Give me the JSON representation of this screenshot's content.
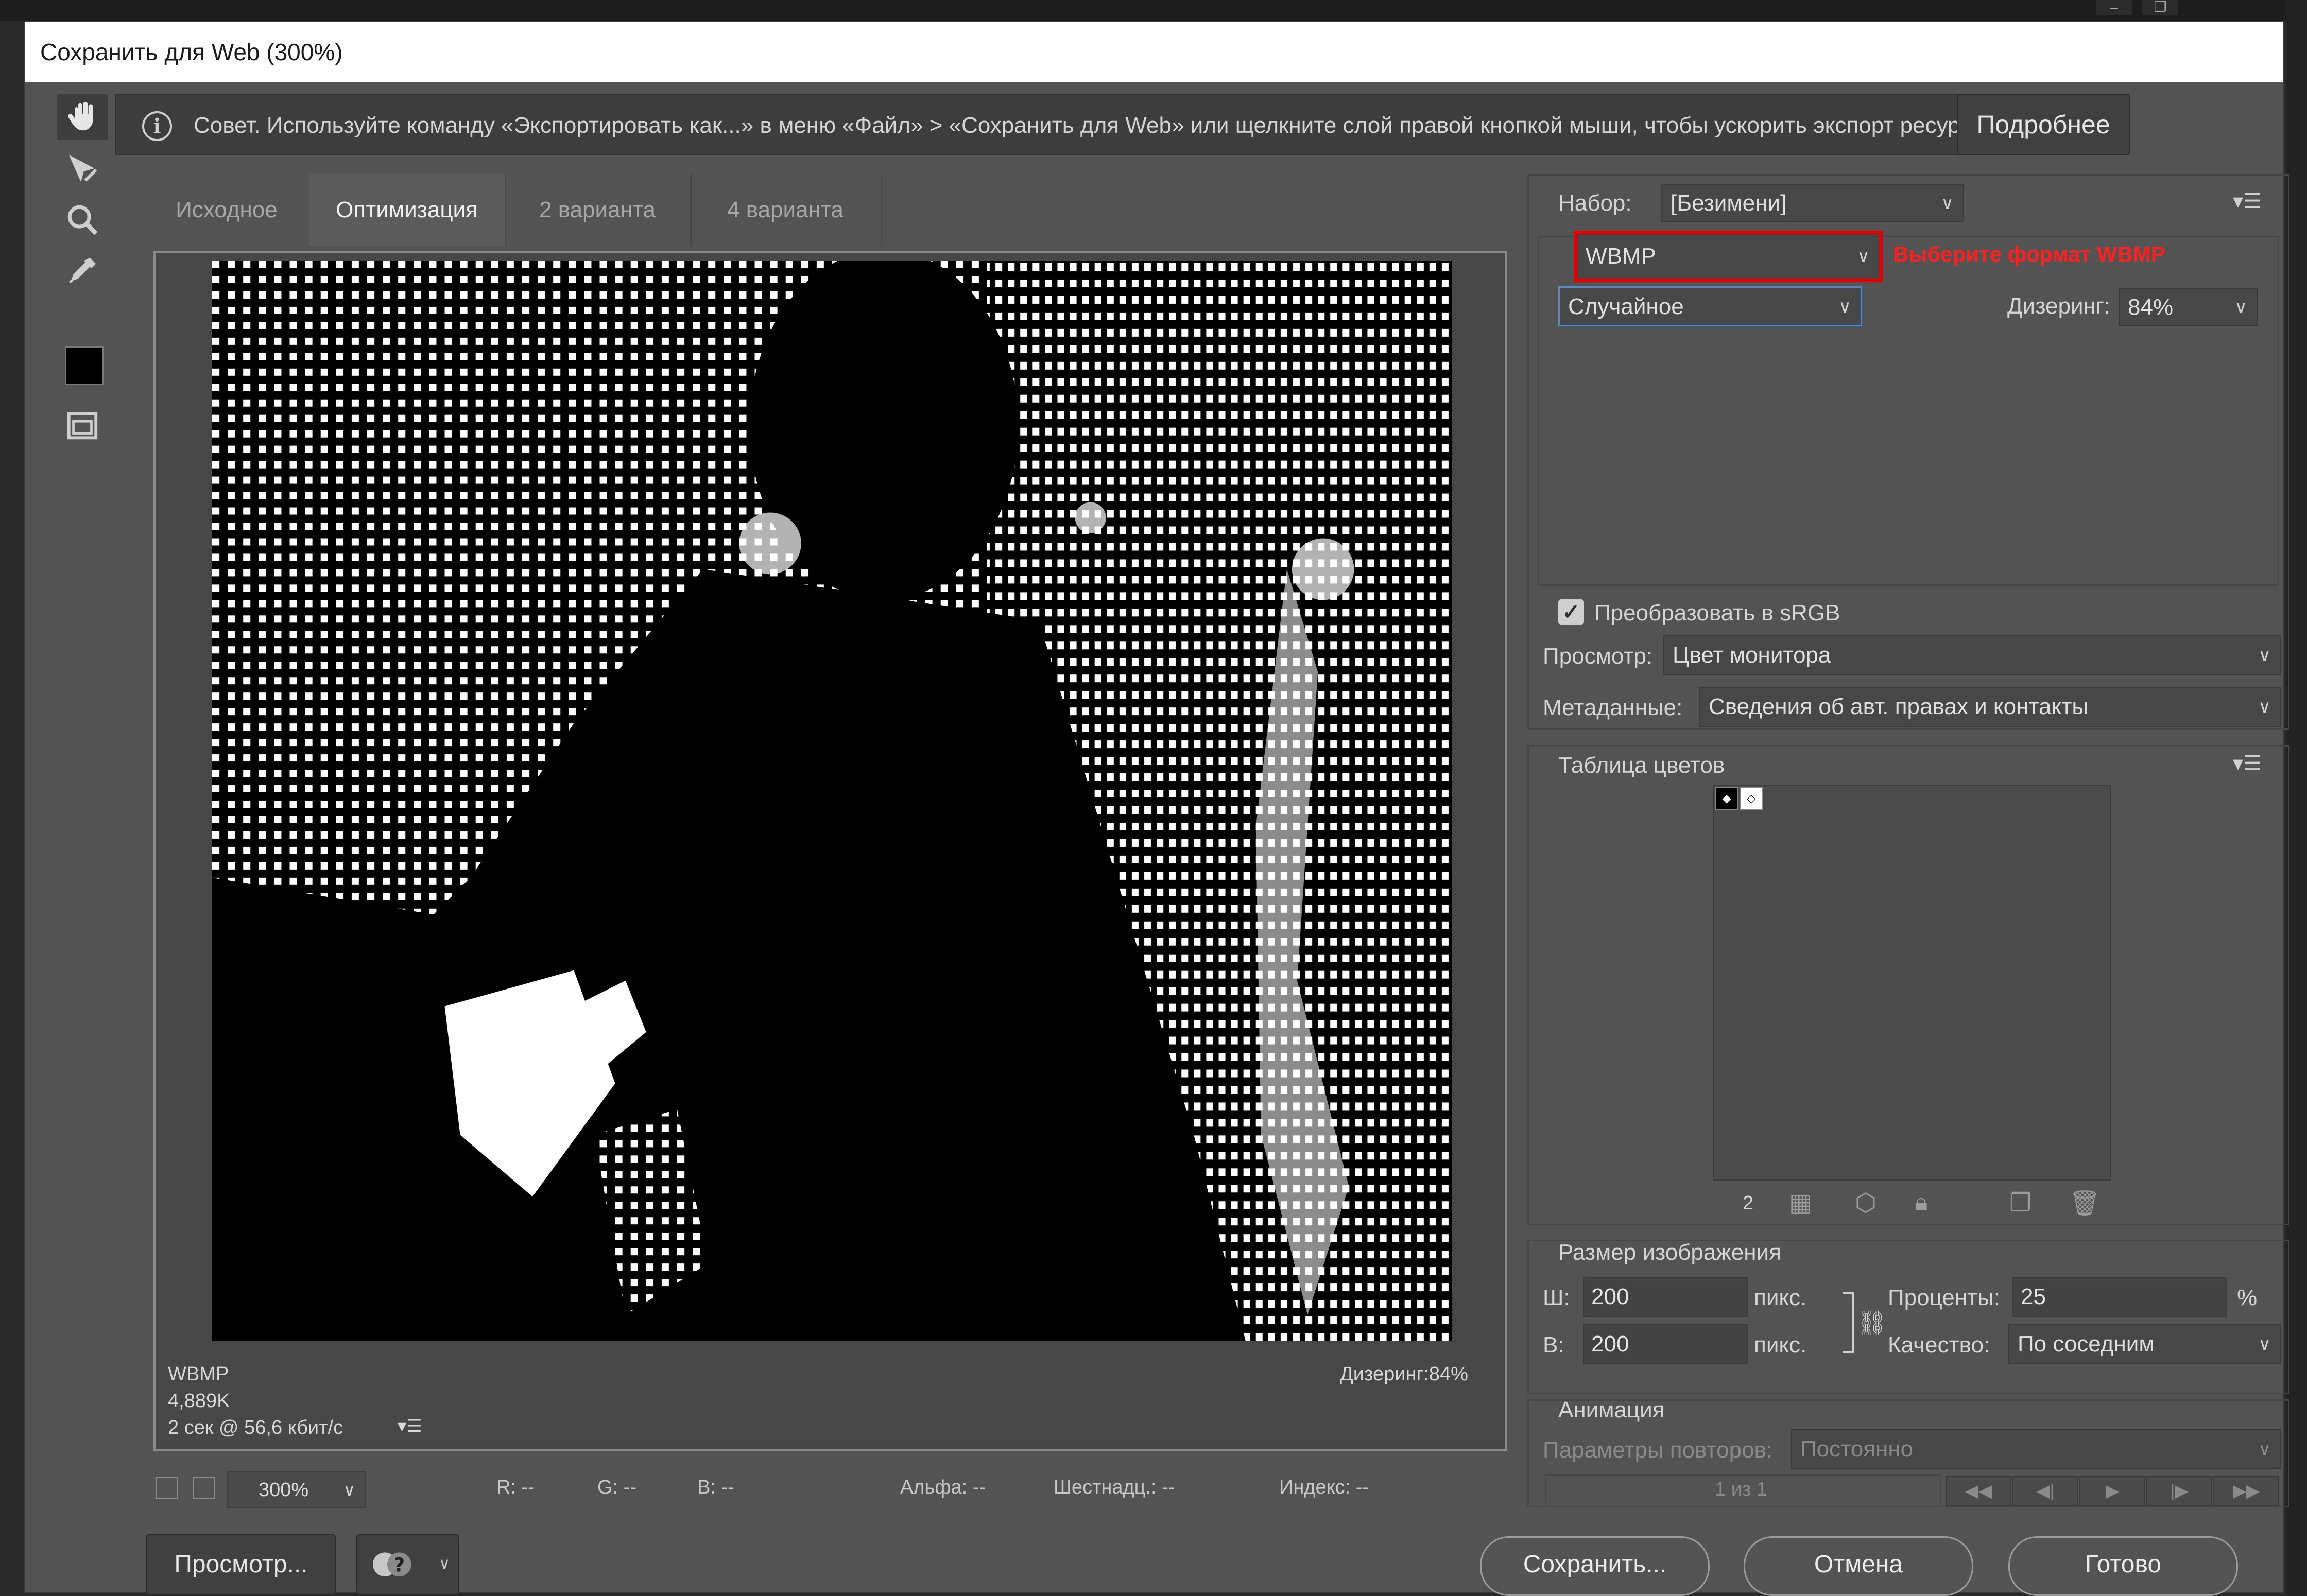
{
  "dialog": {
    "title": "Сохранить для Web (300%)"
  },
  "tip": {
    "icon": "info-icon",
    "text": "Совет. Используйте команду «Экспортировать как...» в меню «Файл» > «Сохранить для Web» или щелкните слой правой кнопкой мыши, чтобы ускорить экспорт ресурсов",
    "more_button": "Подробнее"
  },
  "tools": [
    {
      "name": "hand-tool",
      "icon": "hand-icon",
      "active": true
    },
    {
      "name": "slice-select-tool",
      "icon": "slice-select-icon"
    },
    {
      "name": "zoom-tool",
      "icon": "zoom-icon"
    },
    {
      "name": "eyedropper-tool",
      "icon": "eyedropper-icon"
    },
    {
      "name": "eyedropper-color",
      "color": "#000000"
    },
    {
      "name": "toggle-slices-tool",
      "icon": "slices-visibility-icon"
    }
  ],
  "tabs": [
    "Исходное",
    "Оптимизация",
    "2 варианта",
    "4 варианта"
  ],
  "active_tab": "Оптимизация",
  "preview": {
    "format": "WBMP",
    "size": "4,889K",
    "speed": "2 сек @ 56,6 кбит/с",
    "dither_info": "Дизеринг:84%"
  },
  "statusbar": {
    "zoom": "300%",
    "r": "R: --",
    "g": "G: --",
    "b": "B: --",
    "alpha": "Альфа: --",
    "hex": "Шестнадц.: --",
    "index": "Индекс: --"
  },
  "buttons": {
    "preview": "Просмотр...",
    "save": "Сохранить...",
    "cancel": "Отмена",
    "done": "Готово"
  },
  "settings": {
    "preset_label": "Набор:",
    "preset_value": "[Безимени]",
    "format_value": "WBMP",
    "annotation": "Выберите формат WBMP",
    "dither_algo": "Случайное",
    "dither_label": "Дизеринг:",
    "dither_value": "84%",
    "convert_srgb_label": "Преобразовать в sRGB",
    "convert_srgb_checked": true,
    "preview_label": "Просмотр:",
    "preview_value": "Цвет монитора",
    "metadata_label": "Метаданные:",
    "metadata_value": "Сведения об авт. правах и контакты"
  },
  "color_table": {
    "title": "Таблица цветов",
    "count": "2",
    "colors": [
      "#000000",
      "#ffffff"
    ]
  },
  "image_size": {
    "title": "Размер изображения",
    "w_label": "Ш:",
    "w_value": "200",
    "h_label": "В:",
    "h_value": "200",
    "unit": "пикс.",
    "percent_label": "Проценты:",
    "percent_value": "25",
    "percent_unit": "%",
    "quality_label": "Качество:",
    "quality_value": "По соседним"
  },
  "animation": {
    "title": "Анимация",
    "loop_label": "Параметры повторов:",
    "loop_value": "Постоянно",
    "frame_counter": "1 из 1"
  },
  "accent": {
    "annotation": "#ff2020",
    "highlight_border": "#e00000",
    "selected_border": "#4d8ad8"
  }
}
